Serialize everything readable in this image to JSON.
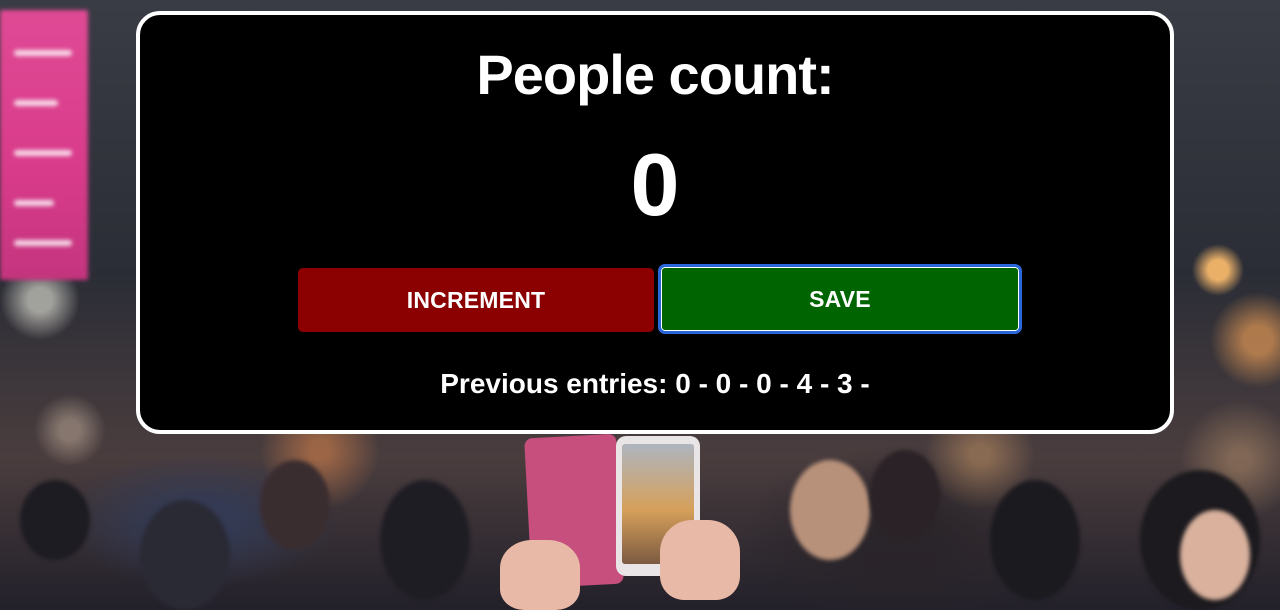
{
  "counter": {
    "title": "People count:",
    "value": "0",
    "increment_label": "INCREMENT",
    "save_label": "SAVE",
    "entries_text": "Previous entries: 0 - 0 - 0 - 4 - 3 -"
  },
  "colors": {
    "panel_background": "#000000",
    "panel_border": "#ffffff",
    "increment_button": "#8b0000",
    "save_button": "#006400",
    "save_focus_ring": "#2a66d9",
    "text": "#ffffff"
  }
}
